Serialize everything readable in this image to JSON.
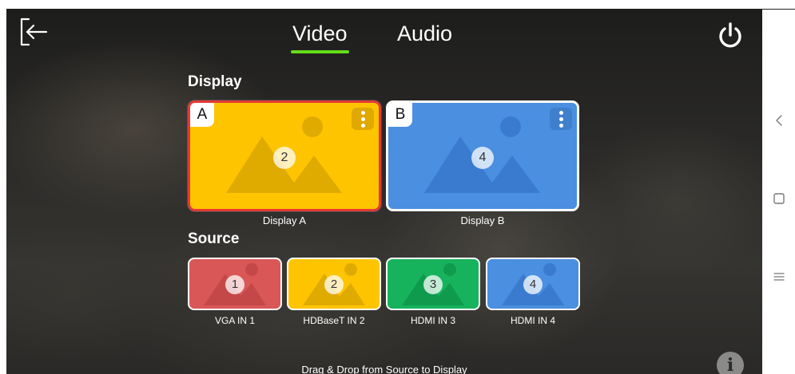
{
  "header": {
    "back_icon": "exit-arrow-icon",
    "power_icon": "power-icon",
    "tabs": [
      {
        "label": "Video",
        "active": true
      },
      {
        "label": "Audio",
        "active": false
      }
    ],
    "active_tab_color": "#64dd17"
  },
  "display": {
    "title": "Display",
    "tiles": [
      {
        "letter": "A",
        "number": "2",
        "caption": "Display A",
        "color": "#ffc400",
        "selected": true
      },
      {
        "letter": "B",
        "number": "4",
        "caption": "Display B",
        "color": "#4a8fe0",
        "selected": false
      }
    ]
  },
  "source": {
    "title": "Source",
    "tiles": [
      {
        "number": "1",
        "caption": "VGA IN 1",
        "color": "#d95757"
      },
      {
        "number": "2",
        "caption": "HDBaseT IN 2",
        "color": "#ffc400"
      },
      {
        "number": "3",
        "caption": "HDMI IN 3",
        "color": "#16b35c"
      },
      {
        "number": "4",
        "caption": "HDMI IN 4",
        "color": "#4a8fe0"
      }
    ]
  },
  "footer": {
    "hint": "Drag & Drop from Source to Display",
    "info_icon": "info-icon"
  },
  "system_nav": {
    "back_icon": "chevron-left-icon",
    "home_icon": "square-home-icon",
    "recents_icon": "menu-lines-icon"
  }
}
